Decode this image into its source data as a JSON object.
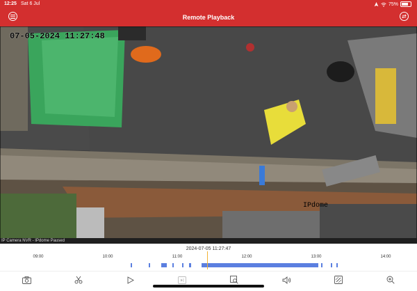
{
  "status_bar": {
    "time": "12:25",
    "date": "Sat 6 Jul",
    "battery": "75%"
  },
  "header": {
    "title": "Remote Playback"
  },
  "video": {
    "osd_timestamp": "07-05-2024  11:27:48",
    "camera_label": "IPdome",
    "status_text": "IP Camera NVR - IPdome Paused"
  },
  "timeline": {
    "current_time": "2024-07-05  11:27:47",
    "hours": [
      "09:00",
      "10:00",
      "11:00",
      "12:00",
      "13:00",
      "14:00"
    ]
  },
  "toolbar": {
    "icons": [
      "camera-icon",
      "scissors-icon",
      "play-icon",
      "frame-step-icon",
      "zoom-image-icon",
      "volume-icon",
      "edit-icon",
      "zoom-in-icon"
    ]
  },
  "colors": {
    "header": "#d32f2f",
    "recording": "#5b7fe0",
    "cursor": "#f2b233"
  }
}
